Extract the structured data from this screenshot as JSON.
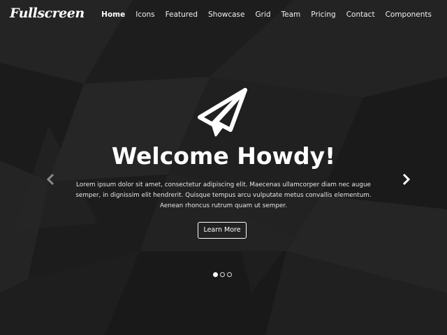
{
  "brand": {
    "name": "Fullscreen"
  },
  "nav": {
    "items": [
      {
        "label": "Home",
        "active": true
      },
      {
        "label": "Icons",
        "active": false
      },
      {
        "label": "Featured",
        "active": false
      },
      {
        "label": "Showcase",
        "active": false
      },
      {
        "label": "Grid",
        "active": false
      },
      {
        "label": "Team",
        "active": false
      },
      {
        "label": "Pricing",
        "active": false
      },
      {
        "label": "Contact",
        "active": false
      },
      {
        "label": "Components",
        "active": false
      }
    ]
  },
  "hero": {
    "icon": "paper-plane-icon",
    "title": "Welcome Howdy!",
    "text": "Lorem ipsum dolor sit amet, consectetur adipiscing elit. Maecenas ullamcorper diam nec augue semper, in dignissim elit hendrerit. Quisque tempus arcu vulputate metus convallis elementum. Aenean rhoncus rutrum quam ut semper.",
    "button_label": "Learn More"
  },
  "carousel": {
    "prev_icon": "chevron-left-icon",
    "next_icon": "chevron-right-icon",
    "slide_count": 3,
    "active_slide": 1
  },
  "colors": {
    "background": "#1f1f1f",
    "text": "#ffffff"
  }
}
